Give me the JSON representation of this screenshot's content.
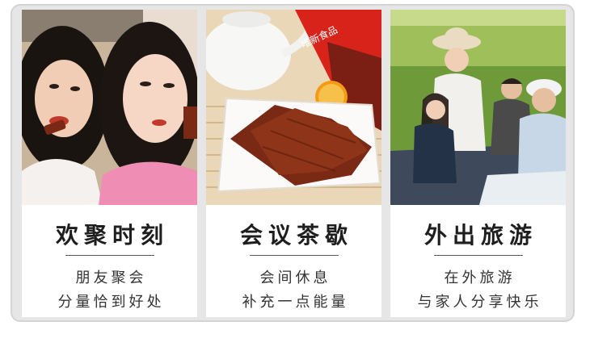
{
  "panels": [
    {
      "title": "欢聚时刻",
      "line1": "朋友聚会",
      "line2": "分量恰到好处",
      "photo": "friends-eating-snack-photo"
    },
    {
      "title": "会议茶歇",
      "line1": "会间休息",
      "line2": "补充一点能量",
      "photo": "jerky-tea-orange-photo"
    },
    {
      "title": "外出旅游",
      "line1": "在外旅游",
      "line2": "与家人分享快乐",
      "photo": "family-picnic-photo"
    }
  ],
  "package_text": "唯新食品",
  "colors": {
    "frame": "#e6e6e6",
    "border": "#d4d4d4",
    "jerky": "#7a2a14",
    "grass": "#6f9a3a",
    "package": "#d8231b"
  }
}
